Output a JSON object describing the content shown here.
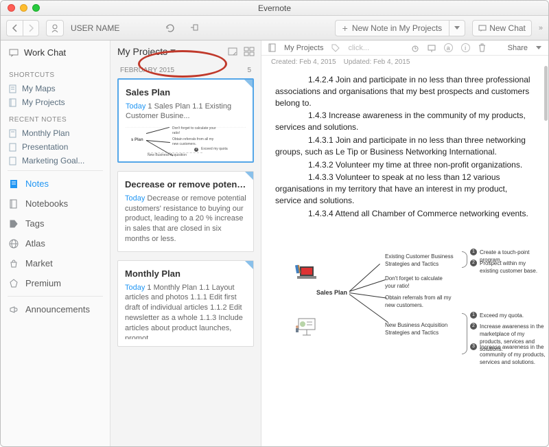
{
  "appTitle": "Evernote",
  "userName": "USER NAME",
  "toolbar": {
    "newNote": "New Note in My Projects",
    "newChat": "New Chat"
  },
  "sidebar": {
    "workChat": "Work Chat",
    "shortcutsHead": "SHORTCUTS",
    "shortcuts": [
      {
        "label": "My Maps"
      },
      {
        "label": "My Projects"
      }
    ],
    "recentHead": "RECENT NOTES",
    "recent": [
      {
        "label": "Monthly Plan"
      },
      {
        "label": "Presentation"
      },
      {
        "label": "Marketing Goal..."
      }
    ],
    "nav": {
      "notes": "Notes",
      "notebooks": "Notebooks",
      "tags": "Tags",
      "atlas": "Atlas",
      "market": "Market",
      "premium": "Premium",
      "announcements": "Announcements"
    }
  },
  "notesPanel": {
    "title": "My Projects",
    "dateHeader": "FEBRUARY 2015",
    "count": "5",
    "cards": [
      {
        "title": "Sales Plan",
        "today": "Today",
        "snippet": " 1 Sales Plan 1.1 Existing Customer Busine...",
        "thumbLabels": {
          "a": "Don't forget to calculate your ratio!",
          "b": "Obtain referrals from all my new customers.",
          "c": "s Plan",
          "d": "Exceed my quota",
          "e": "New Business Acquisition"
        }
      },
      {
        "title": "Decrease or remove potential customers'…",
        "today": "Today",
        "snippet": " Decrease or remove potential customers' resistance to buying our product, leading to a 20 % increase in sales that are closed in six months or less."
      },
      {
        "title": "Monthly Plan",
        "today": "Today",
        "snippet": " 1 Monthly Plan 1.1 Layout articles and photos 1.1.1 Edit first draft of individual articles 1.1.2 Edit newsletter as a whole 1.1.3 Include articles about product launches, promot…"
      }
    ]
  },
  "detail": {
    "breadcrumb": "My Projects",
    "clickPlaceholder": "click...",
    "share": "Share",
    "createdLabel": "Created:",
    "createdDate": "Feb 4, 2015",
    "updatedLabel": "Updated:",
    "updatedDate": "Feb 4, 2015",
    "body": [
      "1.4.2.4 Join and participate in no less than three professional  associations and organisations that my best prospects and customers belong to.",
      "1.4.3 Increase awareness in the community  of my products, services and solutions.",
      "1.4.3.1 Join and participate in no less than three networking groups, such as Le Tip or Business Networking International.",
      "1.4.3.2 Volunteer my time at three non-profit organizations.",
      "1.4.3.3 Volunteer to speak at no less than 12 various  organisations in my territory that have an interest in my product, service and solutions.",
      "1.4.3.4 Attend all Chamber of Commerce networking events."
    ],
    "diagram": {
      "center": "Sales Plan",
      "nodes": {
        "existing": "Existing Customer Business Strategies and Tactics",
        "calc": "Don't forget to calculate your ratio!",
        "referrals": "Obtain referrals from all my new customers.",
        "newbiz": "New Business Acquisition Strategies and Tactics",
        "d1": "Create a touch-point program.",
        "d2": "Prospect within my existing customer base.",
        "d3": "Exceed my quota.",
        "d4": "Increase awareness in the marketplace of my products, services and solutions.",
        "d5": "Increase awareness in the community of my products, services and solutions."
      }
    }
  }
}
